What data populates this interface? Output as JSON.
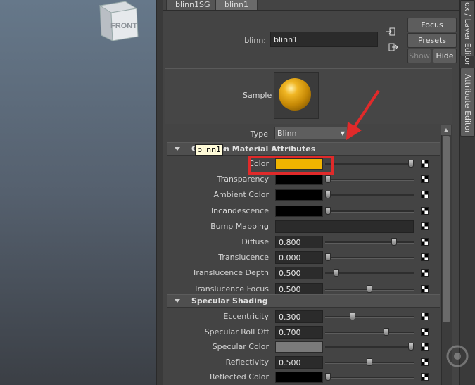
{
  "viewport": {
    "viewcube_label": "FRONT"
  },
  "tabs": [
    {
      "label": "blinn1SG"
    },
    {
      "label": "blinn1"
    }
  ],
  "header": {
    "name_label": "blinn:",
    "name_value": "blinn1",
    "buttons": {
      "focus": "Focus",
      "presets": "Presets",
      "show": "Show",
      "hide": "Hide"
    }
  },
  "sample": {
    "label": "Sample",
    "swatch_color": "#e0a010"
  },
  "type": {
    "label": "Type",
    "value": "Blinn"
  },
  "tooltip": {
    "text": "blinn1"
  },
  "common_section": {
    "title": "Common Material Attributes",
    "rows": [
      {
        "label": "Color",
        "kind": "swatch",
        "color": "#f0b400",
        "slider": 1.0
      },
      {
        "label": "Transparency",
        "kind": "swatch",
        "color": "#000000",
        "slider": 0.0
      },
      {
        "label": "Ambient Color",
        "kind": "swatch",
        "color": "#000000",
        "slider": 0.0
      },
      {
        "label": "Incandescence",
        "kind": "swatch",
        "color": "#000000",
        "slider": 0.0
      },
      {
        "label": "Bump Mapping",
        "kind": "field",
        "value": ""
      },
      {
        "label": "Diffuse",
        "kind": "number",
        "value": "0.800",
        "slider": 0.8
      },
      {
        "label": "Translucence",
        "kind": "number",
        "value": "0.000",
        "slider": 0.0
      },
      {
        "label": "Translucence Depth",
        "kind": "number",
        "value": "0.500",
        "slider": 0.1
      },
      {
        "label": "Translucence Focus",
        "kind": "number",
        "value": "0.500",
        "slider": 0.5
      }
    ]
  },
  "specular_section": {
    "title": "Specular Shading",
    "rows": [
      {
        "label": "Eccentricity",
        "kind": "number",
        "value": "0.300",
        "slider": 0.3
      },
      {
        "label": "Specular Roll Off",
        "kind": "number",
        "value": "0.700",
        "slider": 0.7
      },
      {
        "label": "Specular Color",
        "kind": "swatch",
        "color": "#7a7a7a",
        "slider": 1.0
      },
      {
        "label": "Reflectivity",
        "kind": "number",
        "value": "0.500",
        "slider": 0.5
      },
      {
        "label": "Reflected Color",
        "kind": "swatch",
        "color": "#000000",
        "slider": 0.0
      }
    ]
  },
  "sidebar": {
    "tab_top": "ox / Layer Editor",
    "tab_attr": "Attribute Editor"
  },
  "colors": {
    "annotation": "#e02a2a",
    "panel": "#444444"
  }
}
